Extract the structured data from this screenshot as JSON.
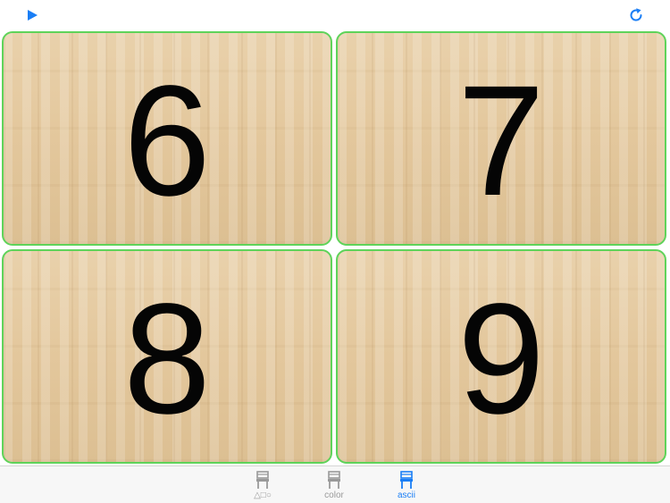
{
  "colors": {
    "accent": "#1a7ef5",
    "card_border": "#5fd35a",
    "inactive": "#9a9a9a",
    "digit": "#050505"
  },
  "toolbar": {
    "play_icon": "play-icon",
    "refresh_icon": "refresh-icon"
  },
  "cards": [
    {
      "label": "6"
    },
    {
      "label": "7"
    },
    {
      "label": "8"
    },
    {
      "label": "9"
    }
  ],
  "tabs": [
    {
      "label": "△□○",
      "icon": "chair-icon",
      "selected": false
    },
    {
      "label": "color",
      "icon": "chair-icon",
      "selected": false
    },
    {
      "label": "ascii",
      "icon": "chair-icon",
      "selected": true
    }
  ]
}
